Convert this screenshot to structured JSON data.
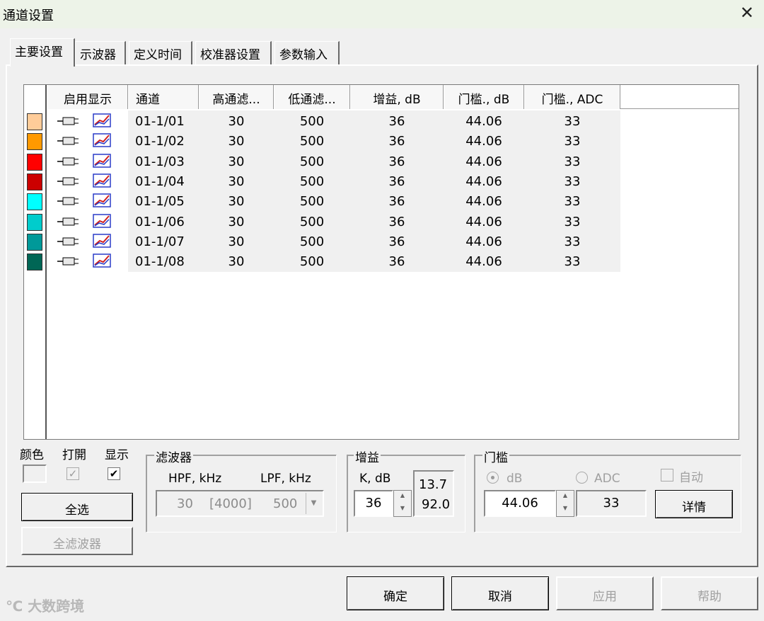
{
  "window": {
    "title": "通道设置"
  },
  "tabs": [
    "主要设置",
    "示波器",
    "定义时间",
    "校准器设置",
    "参数输入"
  ],
  "table": {
    "columns": [
      "启用显示",
      "通道",
      "高通滤...",
      "低通滤...",
      "增益, dB",
      "门槛., dB",
      "门槛., ADC"
    ],
    "rows": [
      {
        "channel": "01-1/01",
        "hpf": "30",
        "lpf": "500",
        "gain": "36",
        "thr_db": "44.06",
        "thr_adc": "33",
        "color": "#ffcc99"
      },
      {
        "channel": "01-1/02",
        "hpf": "30",
        "lpf": "500",
        "gain": "36",
        "thr_db": "44.06",
        "thr_adc": "33",
        "color": "#ff9900"
      },
      {
        "channel": "01-1/03",
        "hpf": "30",
        "lpf": "500",
        "gain": "36",
        "thr_db": "44.06",
        "thr_adc": "33",
        "color": "#ff0000"
      },
      {
        "channel": "01-1/04",
        "hpf": "30",
        "lpf": "500",
        "gain": "36",
        "thr_db": "44.06",
        "thr_adc": "33",
        "color": "#cc0000"
      },
      {
        "channel": "01-1/05",
        "hpf": "30",
        "lpf": "500",
        "gain": "36",
        "thr_db": "44.06",
        "thr_adc": "33",
        "color": "#00ffff"
      },
      {
        "channel": "01-1/06",
        "hpf": "30",
        "lpf": "500",
        "gain": "36",
        "thr_db": "44.06",
        "thr_adc": "33",
        "color": "#00cccc"
      },
      {
        "channel": "01-1/07",
        "hpf": "30",
        "lpf": "500",
        "gain": "36",
        "thr_db": "44.06",
        "thr_adc": "33",
        "color": "#009999"
      },
      {
        "channel": "01-1/08",
        "hpf": "30",
        "lpf": "500",
        "gain": "36",
        "thr_db": "44.06",
        "thr_adc": "33",
        "color": "#006655"
      }
    ]
  },
  "left_controls": {
    "color_label": "颜色",
    "open_label": "打開",
    "show_label": "显示",
    "select_all": "全选",
    "all_filters": "全滤波器"
  },
  "filter_group": {
    "title": "滤波器",
    "hpf_label": "HPF, kHz",
    "lpf_label": "LPF, kHz",
    "hpf_value": "30",
    "range_value": "[4000]",
    "lpf_value": "500"
  },
  "gain_group": {
    "title": "增益",
    "k_label": "K, dB",
    "k_value": "36",
    "value_top": "13.7",
    "value_bottom": "92.0"
  },
  "threshold_group": {
    "title": "门槛",
    "db_label": "dB",
    "adc_label": "ADC",
    "auto_label": "自动",
    "db_value": "44.06",
    "adc_value": "33",
    "details": "详情"
  },
  "footer": {
    "ok": "确定",
    "cancel": "取消",
    "apply": "应用",
    "help": "帮助"
  },
  "watermark": "大数跨境"
}
